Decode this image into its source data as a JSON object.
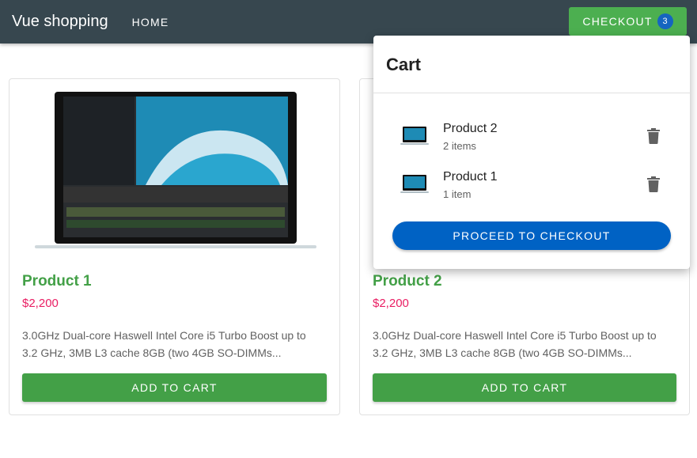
{
  "appbar": {
    "brand": "Vue shopping",
    "home_label": "HOME",
    "checkout_label": "CHECKOUT",
    "cart_count": "3",
    "bg_color": "#37474f",
    "checkout_color": "#4caf50"
  },
  "products": [
    {
      "name": "Product 1",
      "price": "$2,200",
      "description": "3.0GHz Dual-core Haswell Intel Core i5 Turbo Boost up to 3.2 GHz, 3MB L3 cache 8GB (two 4GB SO-DIMMs...",
      "add_label": "ADD TO CART",
      "image_icon": "laptop-image"
    },
    {
      "name": "Product 2",
      "price": "$2,200",
      "description": "3.0GHz Dual-core Haswell Intel Core i5 Turbo Boost up to 3.2 GHz, 3MB L3 cache 8GB (two 4GB SO-DIMMs...",
      "add_label": "ADD TO CART",
      "image_icon": "laptop-image"
    }
  ],
  "cart": {
    "title": "Cart",
    "items": [
      {
        "name": "Product 2",
        "quantity": "2 items",
        "icon": "trash-icon"
      },
      {
        "name": "Product 1",
        "quantity": "1 item",
        "icon": "trash-icon"
      }
    ],
    "proceed_label": "PROCEED TO CHECKOUT",
    "proceed_color": "#0062c4"
  }
}
